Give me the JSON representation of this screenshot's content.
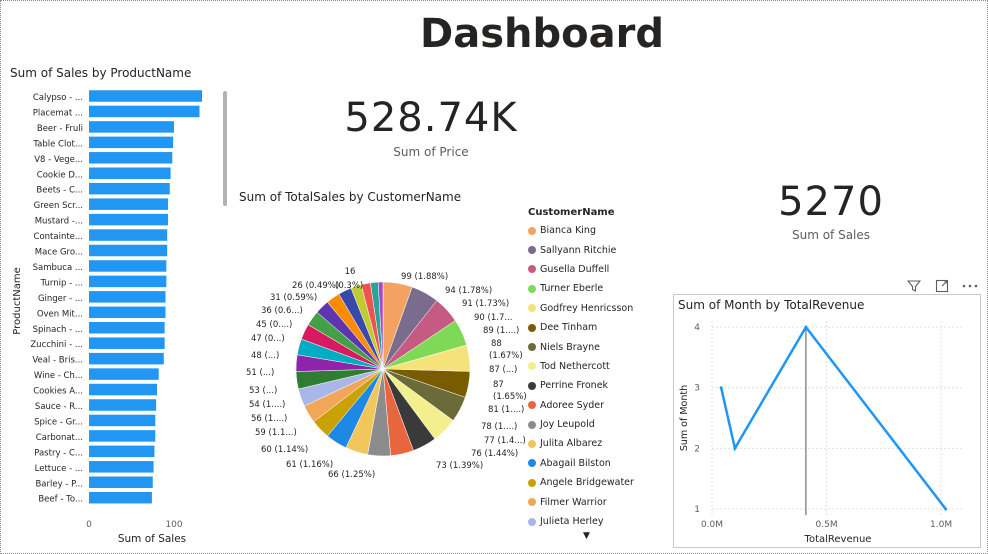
{
  "dashboard": {
    "title": "Dashboard"
  },
  "kpis": [
    {
      "value": "528.74K",
      "label": "Sum of Price"
    },
    {
      "value": "5270",
      "label": "Sum of Sales"
    }
  ],
  "bar_panel": {
    "title": "Sum of Sales by ProductName"
  },
  "pie_panel": {
    "title": "Sum of TotalSales by CustomerName"
  },
  "line_panel": {
    "title": "Sum of Month by TotalRevenue"
  },
  "legend": {
    "title": "CustomerName",
    "items": [
      {
        "name": "Bianca King",
        "color": "#f4a261"
      },
      {
        "name": "Sallyann Ritchie",
        "color": "#7b6b8d"
      },
      {
        "name": "Gusella Duffell",
        "color": "#c75a82"
      },
      {
        "name": "Turner Eberle",
        "color": "#7ed957"
      },
      {
        "name": "Godfrey Henricsson",
        "color": "#f6e27a"
      },
      {
        "name": "Dee Tinham",
        "color": "#7a5c00"
      },
      {
        "name": "Niels Brayne",
        "color": "#6b6b3a"
      },
      {
        "name": "Tod Nethercott",
        "color": "#f3ef8f"
      },
      {
        "name": "Perrine Fronek",
        "color": "#3a3a3a"
      },
      {
        "name": "Adoree Syder",
        "color": "#e8663d"
      },
      {
        "name": "Joy Leupold",
        "color": "#8c8c8c"
      },
      {
        "name": "Julita Albarez",
        "color": "#f1c75b"
      },
      {
        "name": "Abagail Bilston",
        "color": "#1e88e5"
      },
      {
        "name": "Angele Bridgewater",
        "color": "#c9a100"
      },
      {
        "name": "Filmer Warrior",
        "color": "#f2a65a"
      },
      {
        "name": "Julieta Herley",
        "color": "#a9b7e8"
      }
    ]
  },
  "toolbar": {
    "filter_icon": "filter-icon",
    "focus_icon": "focus-mode-icon",
    "more_icon": "more-options-icon"
  },
  "chart_data": [
    {
      "type": "bar",
      "orientation": "horizontal",
      "title": "Sum of Sales by ProductName",
      "xlabel": "Sum of Sales",
      "ylabel": "ProductName",
      "xlim": [
        0,
        140
      ],
      "xticks": [
        "0",
        "100"
      ],
      "color": "#2196f3",
      "categories": [
        "Calypso - ...",
        "Placemat ...",
        "Beer - Fruli",
        "Table Clot...",
        "V8 - Vege...",
        "Cookie D...",
        "Beets - C...",
        "Green Scr...",
        "Mustard -...",
        "Containte...",
        "Mace Gro...",
        "Sambuca ...",
        "Turnip - ...",
        "Ginger - ...",
        "Oven Mit...",
        "Spinach - ...",
        "Zucchini - ...",
        "Veal - Bris...",
        "Wine - Ch...",
        "Cookies A...",
        "Sauce - R...",
        "Spice - Gr...",
        "Carbonat...",
        "Pastry - C...",
        "Lettuce - ...",
        "Barley - P...",
        "Beef - To..."
      ],
      "values": [
        133,
        130,
        100,
        99,
        98,
        96,
        95,
        93,
        93,
        92,
        92,
        91,
        91,
        90,
        90,
        89,
        89,
        88,
        82,
        80,
        79,
        78,
        78,
        77,
        76,
        75,
        74
      ]
    },
    {
      "type": "pie",
      "title": "Sum of TotalSales by CustomerName",
      "data_labels": [
        "99 (1.88%)",
        "94 (1.78%)",
        "91 (1.73%)",
        "90 (1.7...",
        "89 (1....)",
        "88",
        "(1.67%)",
        "87 (...)",
        "87",
        "(1.65%)",
        "81 (1....)",
        "78 (1....)",
        "77 (1.4...)",
        "76 (1.44%)",
        "73 (1.39%)",
        "66 (1.25%)",
        "61 (1.16%)",
        "60 (1.14%)",
        "59 (1.1...)",
        "56 (1....)",
        "54 (1....)",
        "53 (...)",
        "51 (...)",
        "48 (...)",
        "47 (0...)",
        "45 (0....)",
        "36 (0.6...)",
        "31 (0.59%)",
        "26 (0.49%)",
        "(0.3%)",
        "16"
      ],
      "slices": [
        {
          "name": "Bianca King",
          "value": 99,
          "color": "#f4a261"
        },
        {
          "name": "Sallyann Ritchie",
          "value": 94,
          "color": "#7b6b8d"
        },
        {
          "name": "Gusella Duffell",
          "value": 91,
          "color": "#c75a82"
        },
        {
          "name": "Turner Eberle",
          "value": 90,
          "color": "#7ed957"
        },
        {
          "name": "Godfrey Henricsson",
          "value": 89,
          "color": "#f6e27a"
        },
        {
          "name": "Dee Tinham",
          "value": 88,
          "color": "#7a5c00"
        },
        {
          "name": "Niels Brayne",
          "value": 87,
          "color": "#6b6b3a"
        },
        {
          "name": "Tod Nethercott",
          "value": 87,
          "color": "#f3ef8f"
        },
        {
          "name": "Perrine Fronek",
          "value": 81,
          "color": "#3a3a3a"
        },
        {
          "name": "Adoree Syder",
          "value": 78,
          "color": "#e8663d"
        },
        {
          "name": "Joy Leupold",
          "value": 77,
          "color": "#8c8c8c"
        },
        {
          "name": "Julita Albarez",
          "value": 76,
          "color": "#f1c75b"
        },
        {
          "name": "Abagail Bilston",
          "value": 73,
          "color": "#1e88e5"
        },
        {
          "name": "Angele Bridgewater",
          "value": 66,
          "color": "#c9a100"
        },
        {
          "name": "Filmer Warrior",
          "value": 61,
          "color": "#f2a65a"
        },
        {
          "name": "Julieta Herley",
          "value": 60,
          "color": "#a9b7e8"
        },
        {
          "name": "",
          "value": 59,
          "color": "#2e7d32"
        },
        {
          "name": "",
          "value": 56,
          "color": "#8e24aa"
        },
        {
          "name": "",
          "value": 54,
          "color": "#00acc1"
        },
        {
          "name": "",
          "value": 53,
          "color": "#d81b60"
        },
        {
          "name": "",
          "value": 51,
          "color": "#43a047"
        },
        {
          "name": "",
          "value": 48,
          "color": "#5e35b1"
        },
        {
          "name": "",
          "value": 47,
          "color": "#fb8c00"
        },
        {
          "name": "",
          "value": 45,
          "color": "#3949ab"
        },
        {
          "name": "",
          "value": 36,
          "color": "#c0ca33"
        },
        {
          "name": "",
          "value": 31,
          "color": "#ef5350"
        },
        {
          "name": "",
          "value": 26,
          "color": "#26a69a"
        },
        {
          "name": "",
          "value": 16,
          "color": "#ab47bc"
        }
      ]
    },
    {
      "type": "line",
      "title": "Sum of Month by TotalRevenue",
      "xlabel": "TotalRevenue",
      "ylabel": "Sum of Month",
      "xticks": [
        "0.0M",
        "0.5M",
        "1.0M"
      ],
      "yticks": [
        "1",
        "2",
        "3",
        "4"
      ],
      "xlim": [
        0,
        1.1
      ],
      "ylim": [
        0.9,
        4.1
      ],
      "color": "#2196f3",
      "x": [
        0.04,
        0.1,
        0.41,
        1.02
      ],
      "y": [
        3,
        2,
        4,
        1
      ]
    }
  ]
}
